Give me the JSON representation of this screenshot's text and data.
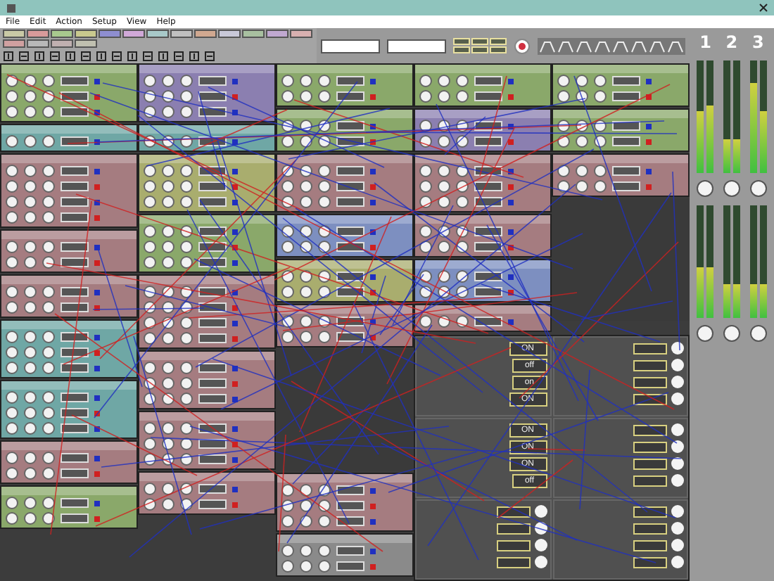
{
  "menu": [
    "File",
    "Edit",
    "Action",
    "Setup",
    "View",
    "Help"
  ],
  "palette": [
    {
      "color": "#c9c9a6"
    },
    {
      "color": "#d89a9a"
    },
    {
      "color": "#a8c98e"
    },
    {
      "color": "#c9c98e"
    },
    {
      "color": "#8e8ed0"
    },
    {
      "color": "#d0a8d8"
    },
    {
      "color": "#a8c9c9"
    },
    {
      "color": "#c0c0c0"
    },
    {
      "color": "#d0a890"
    },
    {
      "color": "#c8c8d8"
    },
    {
      "color": "#a8c0a0"
    },
    {
      "color": "#c0a8d0"
    },
    {
      "color": "#d8b0b0"
    },
    {
      "color": "#d0a0a0"
    },
    {
      "color": "#b8b8b8"
    },
    {
      "color": "#c0b0b0"
    },
    {
      "color": "#c0c0b0"
    }
  ],
  "columns": [
    [
      {
        "kind": "module",
        "color": "#8aa86a"
      },
      {
        "kind": "module",
        "color": "#6fa7a5"
      },
      {
        "kind": "module",
        "color": "#a57c80"
      },
      {
        "kind": "module",
        "color": "#a57c80"
      },
      {
        "kind": "module",
        "color": "#a57c80"
      },
      {
        "kind": "module",
        "color": "#6fa7a5"
      },
      {
        "kind": "module",
        "color": "#6fa7a5"
      },
      {
        "kind": "module",
        "color": "#a57c80"
      },
      {
        "kind": "module",
        "color": "#8aa86a"
      }
    ],
    [
      {
        "kind": "module",
        "color": "#8b7fb0"
      },
      {
        "kind": "module",
        "color": "#6fa7a5"
      },
      {
        "kind": "module",
        "color": "#a9ad6e"
      },
      {
        "kind": "module",
        "color": "#8aa86a"
      },
      {
        "kind": "module",
        "color": "#a57c80"
      },
      {
        "kind": "module",
        "color": "#a57c80"
      },
      {
        "kind": "module",
        "color": "#a57c80"
      },
      {
        "kind": "module",
        "color": "#a57c80"
      }
    ],
    [
      {
        "kind": "module",
        "color": "#8aa86a"
      },
      {
        "kind": "module",
        "color": "#8aa86a"
      },
      {
        "kind": "module",
        "color": "#a57c80"
      },
      {
        "kind": "module",
        "color": "#7d8fc0"
      },
      {
        "kind": "module",
        "color": "#a9ad6e"
      },
      {
        "kind": "module",
        "color": "#a57c80"
      },
      {
        "kind": "gap"
      },
      {
        "kind": "module",
        "color": "#a57c80"
      },
      {
        "kind": "module",
        "color": "#8a8a8a"
      }
    ],
    [
      {
        "kind": "module",
        "color": "#8aa86a"
      },
      {
        "kind": "module",
        "color": "#8b7fb0"
      },
      {
        "kind": "module",
        "color": "#a57c80"
      },
      {
        "kind": "module",
        "color": "#a57c80"
      },
      {
        "kind": "module",
        "color": "#7d8fc0"
      },
      {
        "kind": "module",
        "color": "#a57c80"
      }
    ],
    [
      {
        "kind": "module",
        "color": "#8aa86a"
      },
      {
        "kind": "module",
        "color": "#8aa86a"
      },
      {
        "kind": "module",
        "color": "#a57c80"
      },
      {
        "kind": "gap"
      }
    ]
  ],
  "parameters": [
    {
      "kind": "switches",
      "values": [
        "ON",
        "off",
        "on",
        "ON"
      ]
    },
    {
      "kind": "knobs"
    },
    {
      "kind": "switches",
      "values": [
        "ON",
        "ON",
        "ON",
        "off"
      ]
    },
    {
      "kind": "knobs"
    },
    {
      "kind": "knobs"
    },
    {
      "kind": "knobs"
    }
  ],
  "mixer": [
    {
      "label": "1",
      "top": [
        {
          "level": 0.55
        },
        {
          "level": 0.6
        }
      ],
      "bottom": [
        {
          "level": 0.45
        },
        {
          "level": 0.45
        }
      ]
    },
    {
      "label": "2",
      "top": [
        {
          "level": 0.3
        },
        {
          "level": 0.3
        }
      ],
      "bottom": [
        {
          "level": 0.3
        },
        {
          "level": 0.3
        }
      ]
    },
    {
      "label": "3",
      "top": [
        {
          "level": 0.8
        },
        {
          "level": 0.55
        }
      ],
      "bottom": [
        {
          "level": 0.3
        },
        {
          "level": 0.3
        }
      ]
    }
  ]
}
